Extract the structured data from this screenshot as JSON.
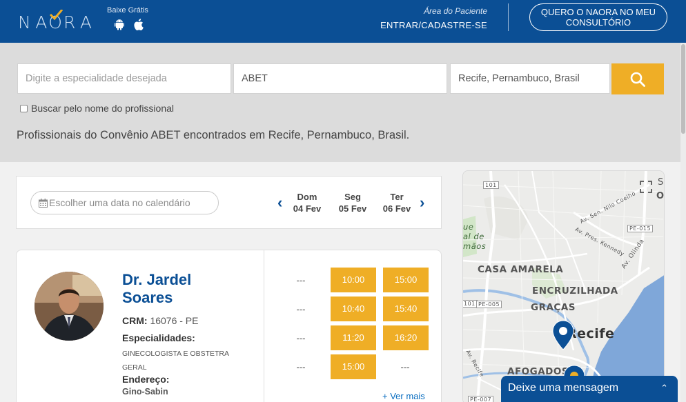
{
  "header": {
    "logo": "NAORA",
    "download_label": "Baixe Grátis",
    "patient_area_label": "Área do Paciente",
    "login_label": "ENTRAR/CADASTRE-SE",
    "cta_label": "QUERO O NAORA NO MEU CONSULTÓRIO"
  },
  "search": {
    "specialty_placeholder": "Digite a especialidade desejada",
    "insurance_value": "ABET",
    "location_value": "Recife, Pernambuco, Brasil",
    "by_name_label": "Buscar pelo nome do profissional",
    "results_text": "Profissionais do Convênio ABET encontrados em Recife, Pernambuco, Brasil."
  },
  "calendar": {
    "pick_date_label": "Escolher uma data no calendário",
    "days": [
      {
        "weekday": "Dom",
        "date": "04 Fev"
      },
      {
        "weekday": "Seg",
        "date": "05 Fev"
      },
      {
        "weekday": "Ter",
        "date": "06 Fev"
      }
    ]
  },
  "doctor": {
    "name_line1": "Dr. Jardel",
    "name_line2": "Soares",
    "crm_label": "CRM:",
    "crm_value": "16076 - PE",
    "specialties_label": "Especialidades:",
    "specialties_line1": "GINECOLOGISTA E OBSTETRA",
    "specialties_line2": "GERAL",
    "address_label": "Endereço:",
    "address_value": "Gino-Sabin",
    "slots": {
      "sun": [
        "---",
        "---",
        "---",
        "---"
      ],
      "mon": [
        "10:00",
        "10:40",
        "11:20",
        "15:00"
      ],
      "tue": [
        "15:00",
        "15:40",
        "16:20",
        "---"
      ]
    },
    "more_label": "+ Ver mais"
  },
  "map": {
    "labels": [
      "CASA AMARELA",
      "ENCRUZILHADA",
      "GRAÇAS",
      "Recife",
      "AFOGADOS"
    ],
    "road_labels": [
      "101",
      "101",
      "PE-005",
      "PE-015",
      "Av. Olinda",
      "Av. Pres. Kennedy",
      "Av. Sen. Nilo Coelho",
      "Av. Recife",
      "PE-007"
    ],
    "edge_text": [
      "ue",
      "al de",
      "mãos",
      "S",
      "O"
    ]
  },
  "chat": {
    "label": "Deixe uma mensagem"
  },
  "colors": {
    "brand_blue": "#0b4f95",
    "accent_orange": "#efae26"
  }
}
